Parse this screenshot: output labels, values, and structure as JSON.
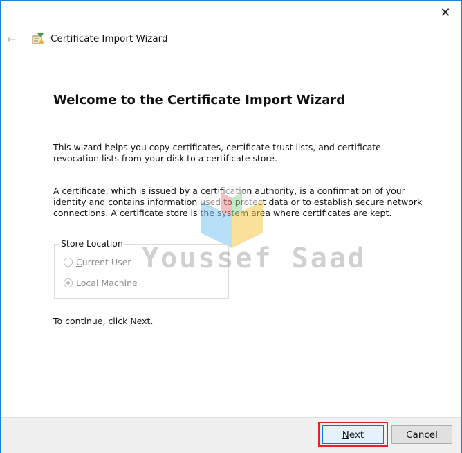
{
  "window": {
    "title": "Certificate Import Wizard",
    "close_glyph": "✕",
    "back_glyph": "←"
  },
  "content": {
    "heading": "Welcome to the Certificate Import Wizard",
    "paragraph1": "This wizard helps you copy certificates, certificate trust lists, and certificate revocation lists from your disk to a certificate store.",
    "paragraph2": "A certificate, which is issued by a certification authority, is a confirmation of your identity and contains information used to protect data or to establish secure network connections. A certificate store is the system area where certificates are kept.",
    "store_location": {
      "label": "Store Location",
      "options": [
        {
          "label": "Current User",
          "checked": false,
          "enabled": false
        },
        {
          "label": "Local Machine",
          "checked": true,
          "enabled": false
        }
      ]
    },
    "continue_text": "To continue, click Next."
  },
  "footer": {
    "next_label": "Next",
    "cancel_label": "Cancel"
  },
  "watermark": {
    "text": "Youssef Saad"
  },
  "colors": {
    "window_border": "#1883d7",
    "highlight": "#e3222b",
    "footer_bg": "#f0f0f0",
    "focus_border": "#0078d7"
  },
  "icons": {
    "back": "back-arrow-icon",
    "wizard": "certificate-wizard-icon",
    "close": "close-icon"
  }
}
